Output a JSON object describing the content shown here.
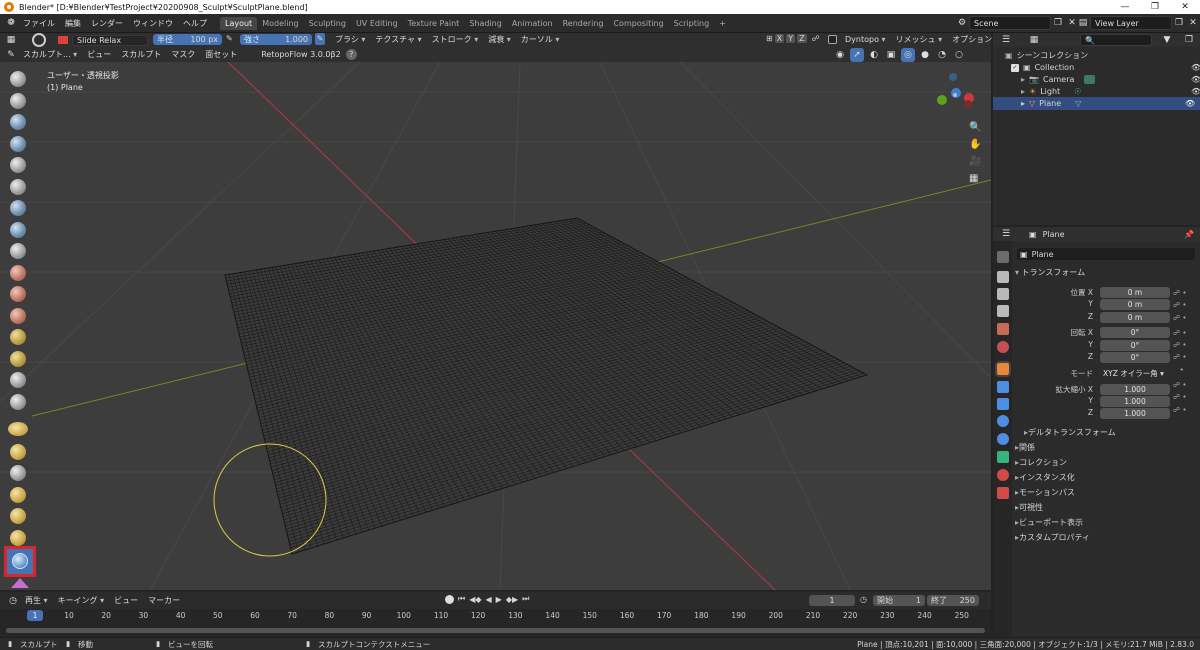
{
  "title_bar": {
    "title": "Blender* [D:¥Blender¥TestProject¥20200908_Sculpt¥SculptPlane.blend]",
    "minimize": "—",
    "maximize": "❐",
    "close": "✕"
  },
  "menu": {
    "items": [
      "ファイル",
      "編集",
      "レンダー",
      "ウィンドウ",
      "ヘルプ"
    ],
    "workspaces": [
      "Layout",
      "Modeling",
      "Sculpting",
      "UV Editing",
      "Texture Paint",
      "Shading",
      "Animation",
      "Rendering",
      "Compositing",
      "Scripting"
    ],
    "add_tab": "+",
    "scene": "Scene",
    "view_layer": "View Layer"
  },
  "tool_header": {
    "brush_name": "Slide Relax",
    "radius_label": "半径",
    "radius_value": "100 px",
    "strength_label": "強さ",
    "strength_value": "1.000",
    "dropdowns": [
      "ブラシ",
      "テクスチャ",
      "ストローク",
      "減衰",
      "カーソル"
    ],
    "axes": [
      "X",
      "Y",
      "Z"
    ],
    "dyntopo": "Dyntopo",
    "remesh": "リメッシュ",
    "options": "オプション"
  },
  "viewport_header": {
    "mode": "スカルプト...",
    "menus": [
      "ビュー",
      "スカルプト",
      "マスク",
      "面セット"
    ],
    "addon": "RetopoFlow 3.0.0β2",
    "help": "?"
  },
  "viewport": {
    "view_name": "ユーザー・透視投影",
    "object_name": "(1) Plane"
  },
  "outliner": {
    "title": "シーンコレクション",
    "collection": "Collection",
    "items": [
      "Camera",
      "Light",
      "Plane"
    ]
  },
  "properties": {
    "object_name": "Plane",
    "object_field": "Plane",
    "transform_header": "トランスフォーム",
    "location_label": "位置 X",
    "location": [
      "0 m",
      "0 m",
      "0 m"
    ],
    "rotation_label": "回転 X",
    "rotation": [
      "0°",
      "0°",
      "0°"
    ],
    "mode_label": "モード",
    "mode_value": "XYZ オイラー角",
    "scale_label": "拡大縮小 X",
    "scale": [
      "1.000",
      "1.000",
      "1.000"
    ],
    "axis_y": "Y",
    "axis_z": "Z",
    "delta": "デルタトランスフォーム",
    "panels": [
      "関係",
      "コレクション",
      "インスタンス化",
      "モーションパス",
      "可視性",
      "ビューポート表示",
      "カスタムプロパティ"
    ]
  },
  "timeline": {
    "menus": [
      "再生",
      "キーイング",
      "ビュー",
      "マーカー"
    ],
    "current_frame": "1",
    "start_label": "開始",
    "start": "1",
    "end_label": "終了",
    "end": "250",
    "ticks": [
      "1",
      "10",
      "20",
      "30",
      "40",
      "50",
      "60",
      "70",
      "80",
      "90",
      "100",
      "110",
      "120",
      "130",
      "140",
      "150",
      "160",
      "170",
      "180",
      "190",
      "200",
      "210",
      "220",
      "230",
      "240",
      "250"
    ]
  },
  "status": {
    "left": "スカルプト",
    "move": "移動",
    "rotate": "ビューを回転",
    "context": "スカルプトコンテクストメニュー",
    "stats": "Plane | 頂点:10,201 | 面:10,000 | 三角面:20,000 | オブジェクト:1/3 | メモリ:21.7 MiB | 2.83.0"
  },
  "colors": {
    "accent": "#4772b3",
    "highlight_red": "#d8262b",
    "brush_circle": "#d9cc46",
    "x_axis": "#b8383c",
    "y_axis": "#6b8c23"
  }
}
